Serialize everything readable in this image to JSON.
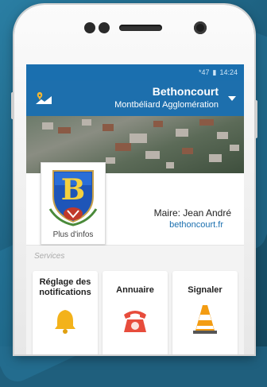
{
  "status_bar": {
    "signal": "*47",
    "battery": "▮",
    "time": "14:24"
  },
  "app_bar": {
    "city": "Bethoncourt",
    "agglomeration": "Montbéliard Agglomération"
  },
  "city_card": {
    "coat_of_arms_link": "Plus d'infos",
    "mayor": "Maire: Jean André",
    "website": "bethoncourt.fr"
  },
  "services": {
    "label": "Services",
    "tiles": [
      {
        "label": "Réglage des notifications",
        "icon": "bell-icon"
      },
      {
        "label": "Annuaire",
        "icon": "phone-icon"
      },
      {
        "label": "Signaler",
        "icon": "traffic-cone-icon"
      }
    ]
  },
  "colors": {
    "app_blue": "#1d6fad",
    "link_blue": "#1a6faf",
    "background": "#1f5f7d"
  }
}
